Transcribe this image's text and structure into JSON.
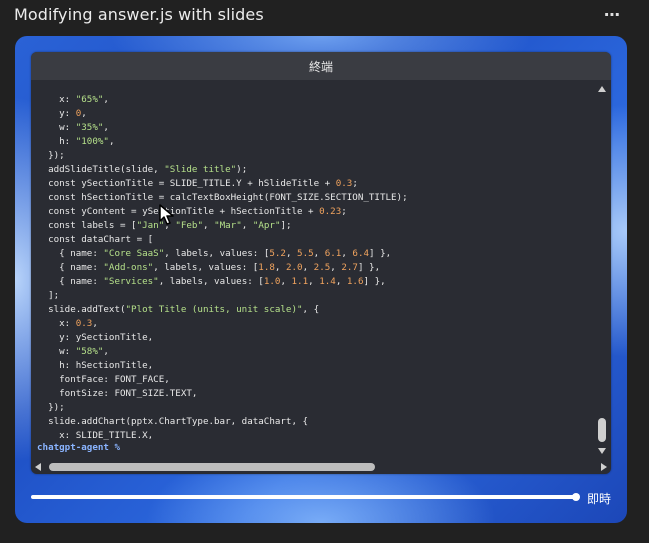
{
  "header": {
    "title": "Modifying answer.js with slides",
    "more_label": "⋯"
  },
  "terminal": {
    "title": "終端",
    "code_lines": [
      "    x: \"65%\",",
      "    y: 0,",
      "    w: \"35%\",",
      "    h: \"100%\",",
      "  });",
      "  addSlideTitle(slide, \"Slide title\");",
      "  const ySectionTitle = SLIDE_TITLE.Y + hSlideTitle + 0.3;",
      "  const hSectionTitle = calcTextBoxHeight(FONT_SIZE.SECTION_TITLE);",
      "  const yContent = ySectionTitle + hSectionTitle + 0.23;",
      "  const labels = [\"Jan\", \"Feb\", \"Mar\", \"Apr\"];",
      "  const dataChart = [",
      "    { name: \"Core SaaS\", labels, values: [5.2, 5.5, 6.1, 6.4] },",
      "    { name: \"Add-ons\", labels, values: [1.8, 2.0, 2.5, 2.7] },",
      "    { name: \"Services\", labels, values: [1.0, 1.1, 1.4, 1.6] },",
      "  ];",
      "  slide.addText(\"Plot Title (units, unit scale)\", {",
      "    x: 0.3,",
      "    y: ySectionTitle,",
      "    w: \"58%\",",
      "    h: hSectionTitle,",
      "    fontFace: FONT_FACE,",
      "    fontSize: FONT_SIZE.TEXT,",
      "  });",
      "  slide.addChart(pptx.ChartType.bar, dataChart, {",
      "    x: SLIDE_TITLE.X,"
    ],
    "prompt": "chatgpt-agent %"
  },
  "playback": {
    "live_label": "即時",
    "progress_fraction": 1.0
  },
  "colors": {
    "string": "#b5e08a",
    "number": "#f0a35e",
    "prompt": "#8ab4ff",
    "terminal_bg": "#2a2c33"
  }
}
